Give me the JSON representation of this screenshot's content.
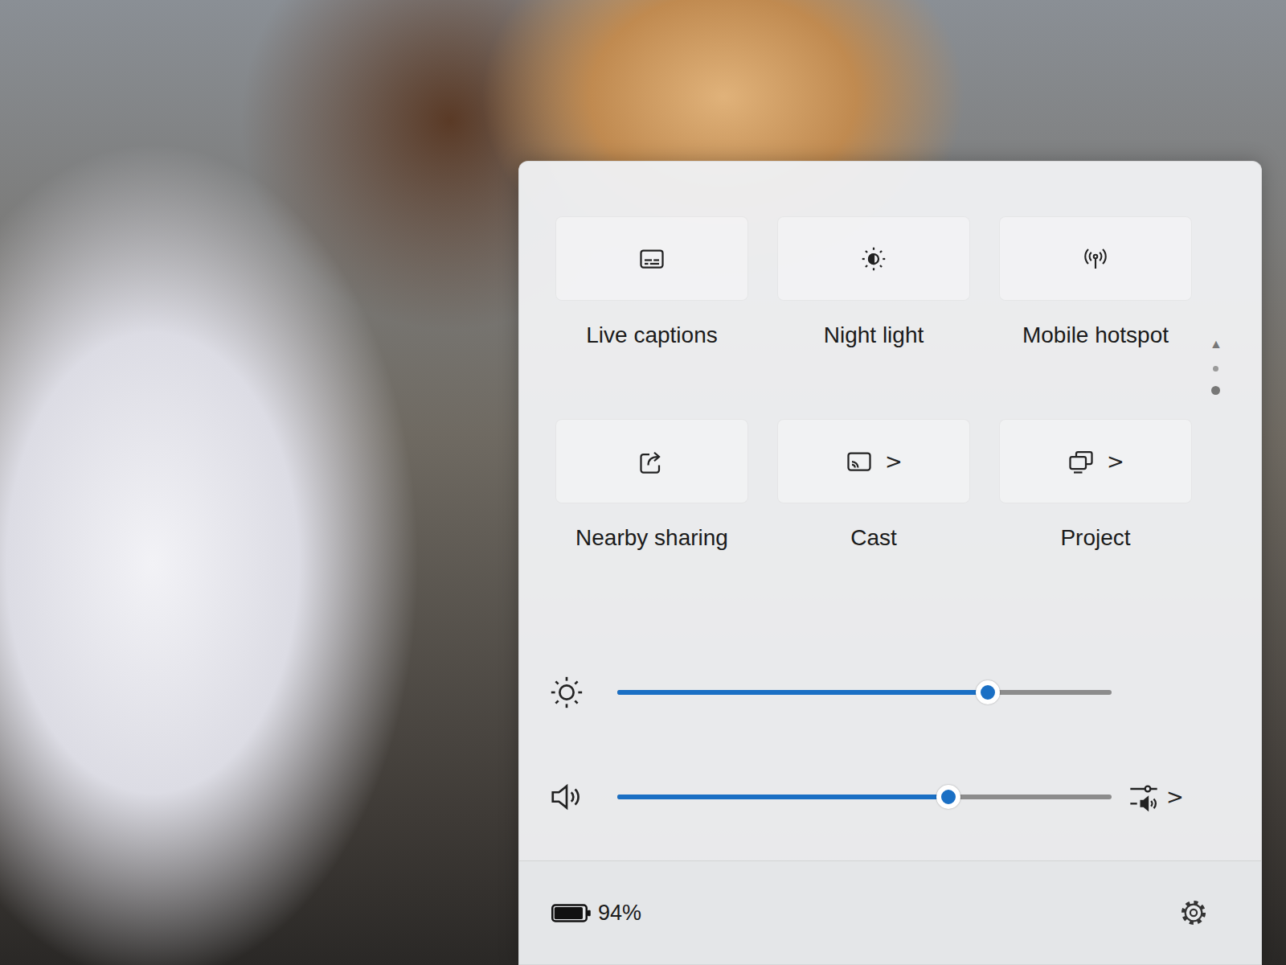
{
  "quick_settings": {
    "tiles": [
      {
        "label": "Live captions",
        "on": false
      },
      {
        "label": "Night light",
        "on": false
      },
      {
        "label": "Mobile hotspot",
        "on": false
      },
      {
        "label": "Nearby sharing",
        "on": false
      },
      {
        "label": "Cast",
        "on": false,
        "chevron": ">"
      },
      {
        "label": "Project",
        "on": false,
        "chevron": ">"
      }
    ],
    "pager": {
      "arrow": "▲",
      "pages": [
        {
          "selected": false
        },
        {
          "selected": true
        }
      ]
    },
    "brightness": {
      "level": 0.75
    },
    "volume": {
      "level": 0.67,
      "mixer_chevron": ">"
    },
    "battery": {
      "reading": "94%",
      "level": 0.94
    }
  }
}
